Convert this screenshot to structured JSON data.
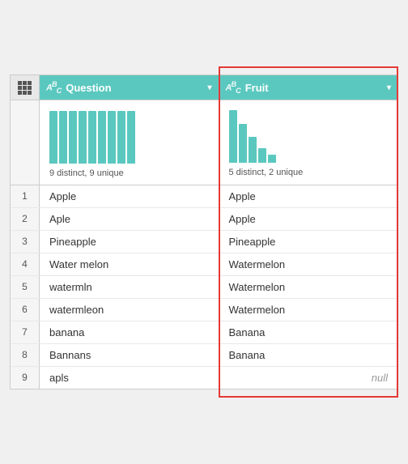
{
  "columns": [
    {
      "id": "row-num",
      "label": ""
    },
    {
      "id": "question",
      "label": "Question",
      "type": "ABC"
    },
    {
      "id": "fruit",
      "label": "Fruit",
      "type": "ABC"
    }
  ],
  "chart": {
    "question": {
      "label": "9 distinct, 9 unique",
      "bars": [
        65,
        65,
        65,
        65,
        65,
        65,
        65,
        65,
        65
      ]
    },
    "fruit": {
      "label": "5 distinct, 2 unique",
      "bars": [
        65,
        48,
        32,
        18,
        10
      ]
    }
  },
  "rows": [
    {
      "num": "1",
      "question": "Apple",
      "fruit": "Apple"
    },
    {
      "num": "2",
      "question": "Aple",
      "fruit": "Apple"
    },
    {
      "num": "3",
      "question": "Pineapple",
      "fruit": "Pineapple"
    },
    {
      "num": "4",
      "question": "Water melon",
      "fruit": "Watermelon"
    },
    {
      "num": "5",
      "question": "watermln",
      "fruit": "Watermelon"
    },
    {
      "num": "6",
      "question": "watermleon",
      "fruit": "Watermelon"
    },
    {
      "num": "7",
      "question": "banana",
      "fruit": "Banana"
    },
    {
      "num": "8",
      "question": "Bannans",
      "fruit": "Banana"
    },
    {
      "num": "9",
      "question": "apls",
      "fruit": null
    }
  ],
  "icons": {
    "grid": "⊞",
    "dropdown": "▾"
  }
}
